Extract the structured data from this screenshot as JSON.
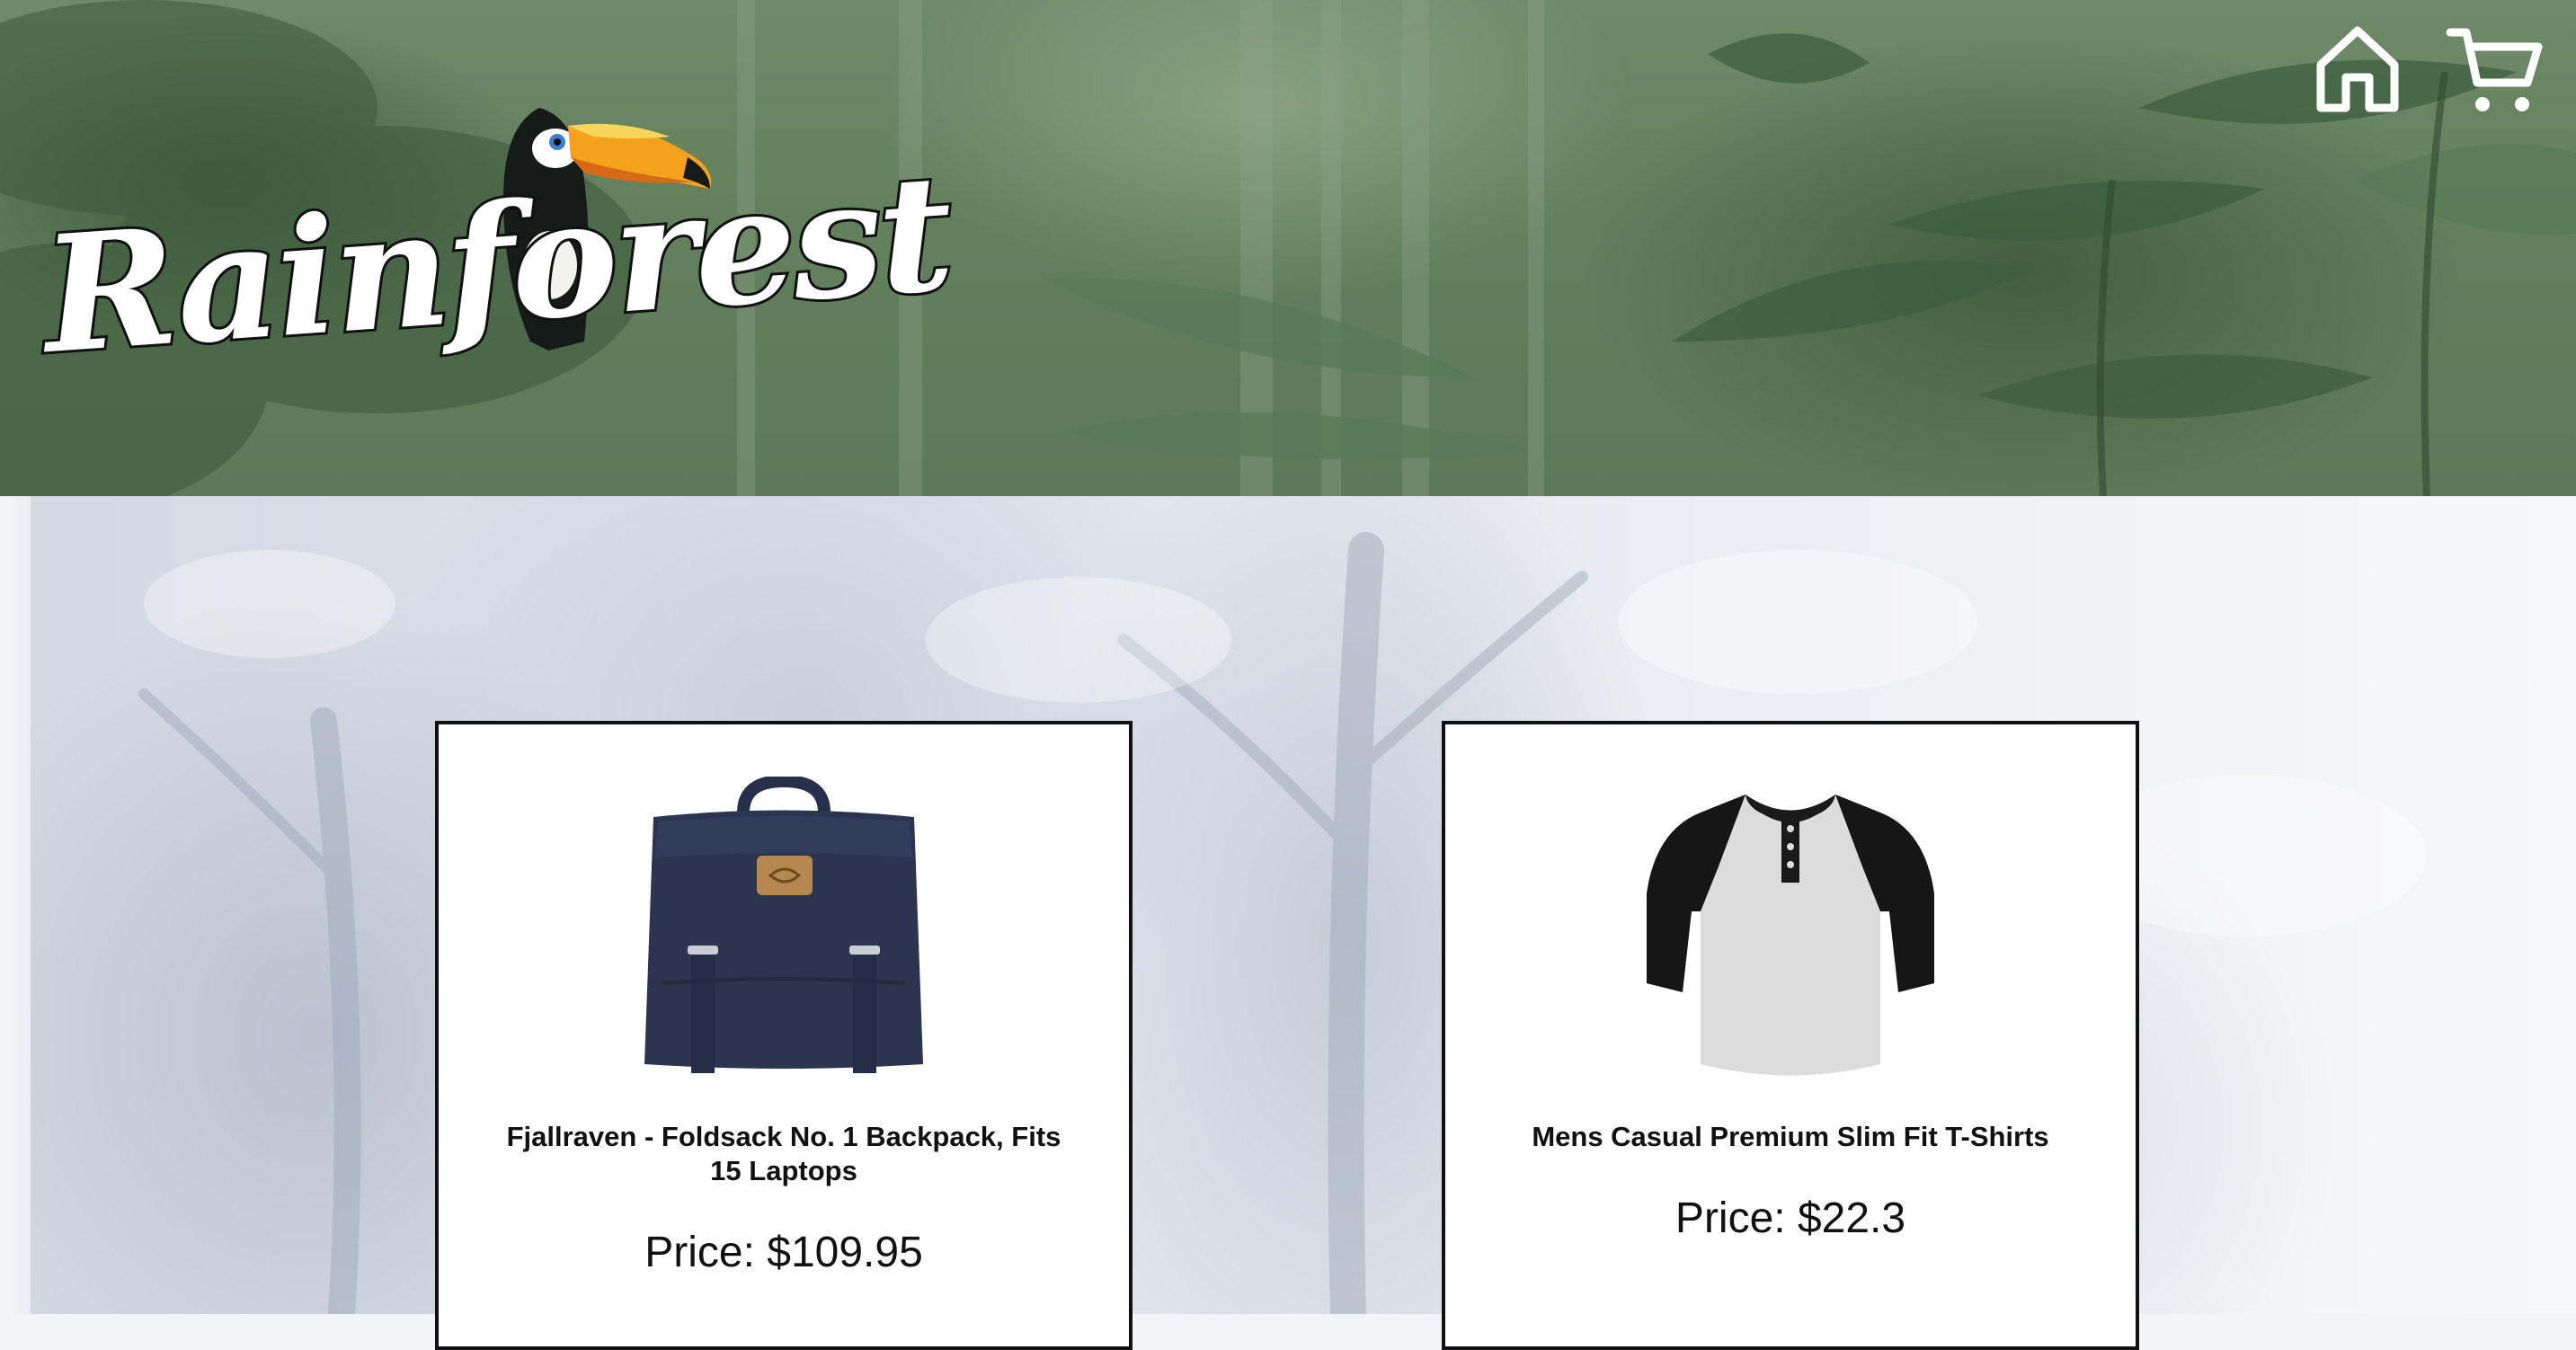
{
  "header": {
    "logo_text": "Rainforest",
    "nav": [
      {
        "icon": "home-icon"
      },
      {
        "icon": "cart-icon"
      }
    ]
  },
  "products": [
    {
      "title": "Fjallraven - Foldsack No. 1 Backpack, Fits 15 Laptops",
      "price": "Price: $109.95",
      "image": "backpack"
    },
    {
      "title": "Mens Casual Premium Slim Fit T-Shirts",
      "price": "Price: $22.3",
      "image": "raglan-t-shirt"
    }
  ],
  "colors": {
    "header_green": "#62805c",
    "card_border": "#111111",
    "backpack_navy": "#2b3550"
  }
}
